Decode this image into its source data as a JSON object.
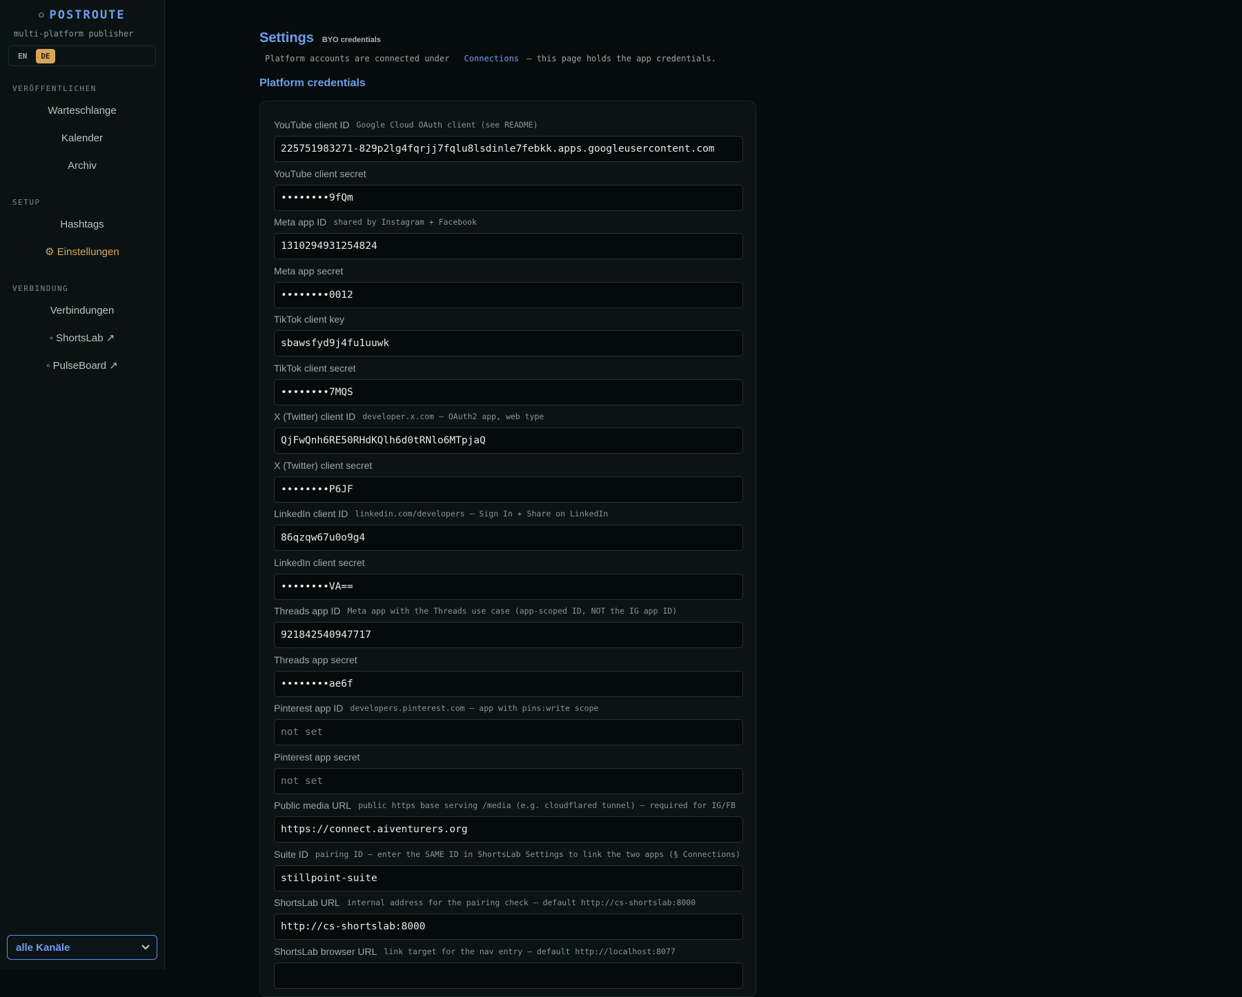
{
  "sidebar": {
    "brand": "POSTROUTE",
    "brand_dot": "○",
    "tagline": "multi-platform publisher",
    "languages": [
      {
        "label": "EN",
        "active": false
      },
      {
        "label": "DE",
        "active": true
      }
    ],
    "sections": [
      {
        "title": "VERÖFFENTLICHEN",
        "items": [
          {
            "label": "Warteschlange"
          },
          {
            "label": "Kalender"
          },
          {
            "label": "Archiv"
          }
        ]
      },
      {
        "title": "SETUP",
        "items": [
          {
            "label": "Hashtags"
          },
          {
            "label": "⚙ Einstellungen",
            "active": true
          }
        ]
      },
      {
        "title": "VERBINDUNG",
        "items": [
          {
            "label": "Verbindungen"
          },
          {
            "label": "◦ ShortsLab ↗"
          },
          {
            "label": "◦ PulseBoard ↗"
          }
        ]
      }
    ],
    "channel_select": {
      "value": "alle Kanäle",
      "chevron_icon": "chevron-down-icon"
    }
  },
  "page": {
    "title": "Settings",
    "badge": "BYO credentials",
    "subtitle_before": "Platform accounts are connected under",
    "subtitle_link": "Connections",
    "subtitle_after": "— this page holds the app credentials.",
    "section_title": "Platform credentials"
  },
  "credentials": [
    {
      "label": "YouTube client ID",
      "hint": "Google Cloud OAuth client (see README)",
      "value": "225751983271-829p2lg4fqrjj7fqlu8lsdinle7febkk.apps.googleusercontent.com"
    },
    {
      "label": "YouTube client secret",
      "hint": "",
      "value": "••••••••9fQm"
    },
    {
      "label": "Meta app ID",
      "hint": "shared by Instagram + Facebook",
      "value": "1310294931254824"
    },
    {
      "label": "Meta app secret",
      "hint": "",
      "value": "••••••••0012"
    },
    {
      "label": "TikTok client key",
      "hint": "",
      "value": "sbawsfyd9j4fu1uuwk"
    },
    {
      "label": "TikTok client secret",
      "hint": "",
      "value": "••••••••7MQS"
    },
    {
      "label": "X (Twitter) client ID",
      "hint": "developer.x.com — OAuth2 app, web type",
      "value": "QjFwQnh6RE50RHdKQlh6d0tRNlo6MTpjaQ"
    },
    {
      "label": "X (Twitter) client secret",
      "hint": "",
      "value": "••••••••P6JF"
    },
    {
      "label": "LinkedIn client ID",
      "hint": "linkedin.com/developers — Sign In + Share on LinkedIn",
      "value": "86qzqw67u0o9g4"
    },
    {
      "label": "LinkedIn client secret",
      "hint": "",
      "value": "••••••••VA=="
    },
    {
      "label": "Threads app ID",
      "hint": "Meta app with the Threads use case (app-scoped ID, NOT the IG app ID)",
      "value": "921842540947717"
    },
    {
      "label": "Threads app secret",
      "hint": "",
      "value": "••••••••ae6f"
    },
    {
      "label": "Pinterest app ID",
      "hint": "developers.pinterest.com — app with pins:write scope",
      "value": "",
      "placeholder": "not set"
    },
    {
      "label": "Pinterest app secret",
      "hint": "",
      "value": "",
      "placeholder": "not set"
    },
    {
      "label": "Public media URL",
      "hint": "public https base serving /media (e.g. cloudflared tunnel) — required for IG/FB",
      "value": "https://connect.aiventurers.org"
    },
    {
      "label": "Suite ID",
      "hint": "pairing ID — enter the SAME ID in ShortsLab Settings to link the two apps (§ Connections)",
      "value": "stillpoint-suite"
    },
    {
      "label": "ShortsLab URL",
      "hint": "internal address for the pairing check — default http://cs-shortslab:8000",
      "value": "http://cs-shortslab:8000"
    },
    {
      "label": "ShortsLab browser URL",
      "hint": "link target for the nav entry — default http://localhost:8077",
      "value": ""
    }
  ]
}
